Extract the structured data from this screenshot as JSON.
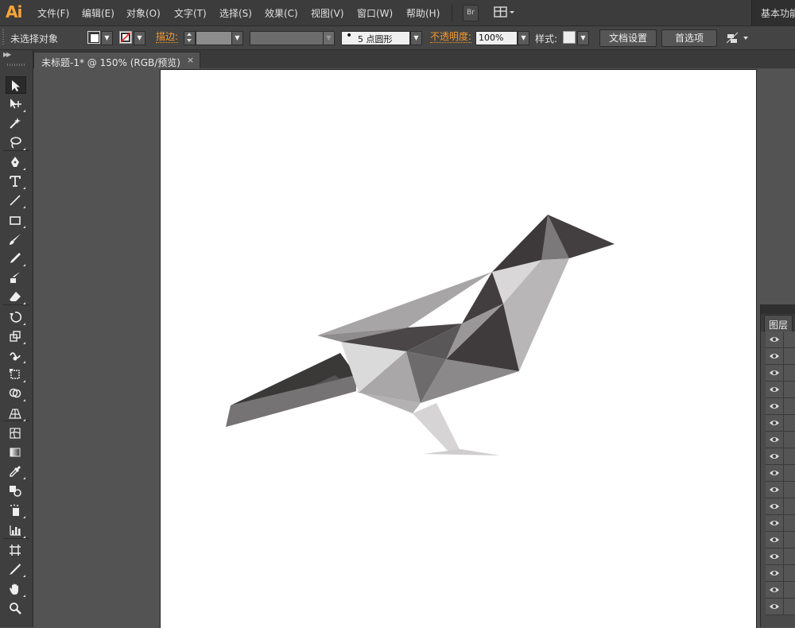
{
  "app": {
    "logo": "Ai"
  },
  "menu": [
    "文件(F)",
    "编辑(E)",
    "对象(O)",
    "文字(T)",
    "选择(S)",
    "效果(C)",
    "视图(V)",
    "窗口(W)",
    "帮助(H)"
  ],
  "menubar_extras": {
    "bridge_label": "Br",
    "workspace_label": "基本功能"
  },
  "control": {
    "selection_status": "未选择对象",
    "stroke_label": "描边:",
    "brush_value": "5 点圆形",
    "opacity_label": "不透明度:",
    "opacity_value": "100%",
    "style_label": "样式:",
    "document_setup": "文档设置",
    "preferences": "首选项"
  },
  "document_tab": {
    "title": "未标题-1* @ 150% (RGB/预览)",
    "close": "×"
  },
  "tools": [
    "selection-tool",
    "direct-selection-tool",
    "magic-wand-tool",
    "lasso-tool",
    "pen-tool",
    "type-tool",
    "line-segment-tool",
    "rectangle-tool",
    "paintbrush-tool",
    "pencil-tool",
    "blob-brush-tool",
    "eraser-tool",
    "rotate-tool",
    "scale-tool",
    "warp-tool",
    "free-transform-tool",
    "shape-builder-tool",
    "perspective-grid-tool",
    "mesh-tool",
    "gradient-tool",
    "eyedropper-tool",
    "blend-tool",
    "symbol-sprayer-tool",
    "column-graph-tool",
    "artboard-tool",
    "slice-tool",
    "hand-tool",
    "zoom-tool"
  ],
  "layers_panel": {
    "tab_label": "图层",
    "row_count": 17
  },
  "colors": {
    "menubar_bg": "#3c3c3c",
    "controlbar_bg": "#444444",
    "workspace_bg": "#535353",
    "accent_orange": "#f59a2e",
    "logo_orange": "#f7a536",
    "artboard": "#ffffff"
  }
}
